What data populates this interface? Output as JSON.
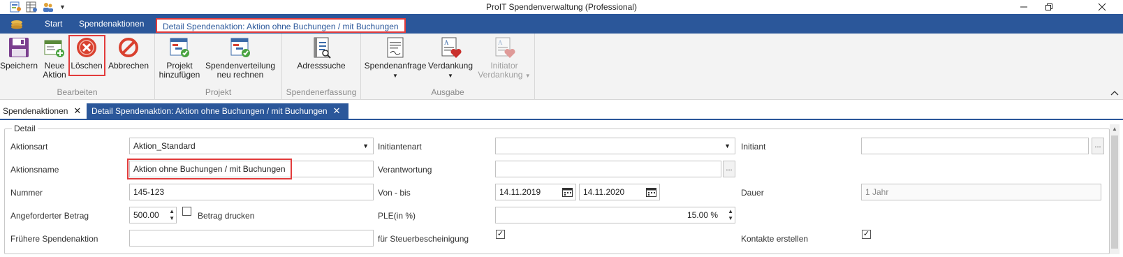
{
  "window": {
    "title": "ProIT Spendenverwaltung (Professional)",
    "controls": [
      "minimize-icon",
      "restore-icon",
      "close-icon"
    ]
  },
  "ribbon_tabs": {
    "start": "Start",
    "spendenaktionen": "Spendenaktionen",
    "context": "Detail Spendenaktion: Aktion ohne Buchungen / mit Buchungen"
  },
  "ribbon": {
    "bearbeiten": {
      "label": "Bearbeiten",
      "speichern": "Speichern",
      "neue_line1": "Neue",
      "neue_line2": "Aktion",
      "loeschen": "Löschen",
      "abbrechen": "Abbrechen"
    },
    "projekt": {
      "label": "Projekt",
      "hinzu_line1": "Projekt",
      "hinzu_line2": "hinzufügen",
      "neu_line1": "Spendenverteilung",
      "neu_line2": "neu rechnen"
    },
    "spendenerfassung": {
      "label": "Spendenerfassung",
      "adresssuche": "Adresssuche"
    },
    "ausgabe": {
      "label": "Ausgabe",
      "anfrage": "Spendenanfrage",
      "verdankung": "Verdankung",
      "init_line1": "Initiator",
      "init_line2": "Verdankung"
    }
  },
  "doc_tabs": {
    "tab1": "Spendenaktionen",
    "tab2": "Detail Spendenaktion: Aktion ohne Buchungen / mit Buchungen"
  },
  "detail": {
    "legend": "Detail",
    "aktionsart_label": "Aktionsart",
    "aktionsart_value": "Aktion_Standard",
    "aktionsname_label": "Aktionsname",
    "aktionsname_value": "Aktion ohne Buchungen / mit Buchungen",
    "nummer_label": "Nummer",
    "nummer_value": "145-123",
    "betrag_label": "Angeforderter Betrag",
    "betrag_value": "500.00",
    "betrag_drucken_label": "Betrag drucken",
    "betrag_drucken_checked": false,
    "fruehere_label": "Frühere Spendenaktion",
    "fruehere_value": "",
    "initiantenart_label": "Initiantenart",
    "initiantenart_value": "",
    "verantwortung_label": "Verantwortung",
    "verantwortung_value": "",
    "vonbis_label": "Von - bis",
    "von_value": "14.11.2019",
    "bis_value": "14.11.2020",
    "ple_label": "PLE(in %)",
    "ple_value": "15.00 %",
    "steuer_label": "für Steuerbescheinigung",
    "steuer_checked": true,
    "initiant_label": "Initiant",
    "initiant_value": "",
    "dauer_label": "Dauer",
    "dauer_value": "1 Jahr",
    "kontakte_label": "Kontakte erstellen",
    "kontakte_checked": true
  },
  "colors": {
    "accent": "#2b579a",
    "highlight": "#e23b3b",
    "delete_red": "#d9412f"
  }
}
